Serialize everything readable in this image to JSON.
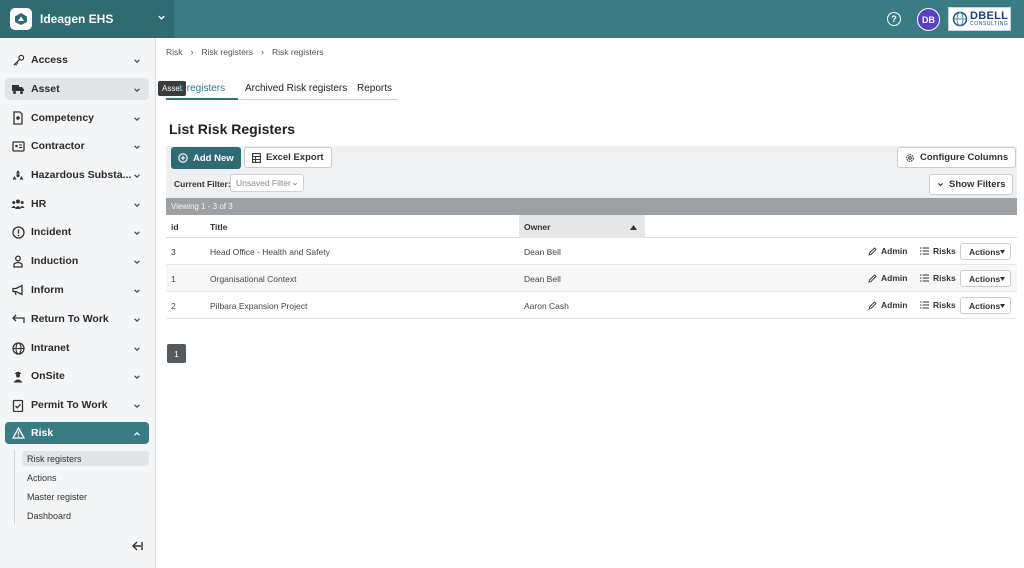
{
  "app": {
    "title": "Ideagen EHS",
    "avatar_initials": "DB",
    "company_logo_line1": "DBELL",
    "company_logo_line2": "CONSULTING",
    "accent": "#3a7c84"
  },
  "sidebar": {
    "items": [
      {
        "label": "Access",
        "icon": "key-icon"
      },
      {
        "label": "Asset",
        "icon": "truck-icon"
      },
      {
        "label": "Competency",
        "icon": "certificate-icon"
      },
      {
        "label": "Contractor",
        "icon": "id-card-icon"
      },
      {
        "label": "Hazardous Substa...",
        "icon": "hazard-icon"
      },
      {
        "label": "HR",
        "icon": "people-icon"
      },
      {
        "label": "Incident",
        "icon": "alert-circle-icon"
      },
      {
        "label": "Induction",
        "icon": "person-badge-icon"
      },
      {
        "label": "Inform",
        "icon": "megaphone-icon"
      },
      {
        "label": "Return To Work",
        "icon": "return-arrow-icon"
      },
      {
        "label": "Intranet",
        "icon": "globe-icon"
      },
      {
        "label": "OnSite",
        "icon": "worker-icon"
      },
      {
        "label": "Permit To Work",
        "icon": "clipboard-check-icon"
      },
      {
        "label": "Risk",
        "icon": "warning-triangle-icon"
      }
    ],
    "risk_sub_items": [
      "Risk registers",
      "Actions",
      "Master register",
      "Dashboard"
    ],
    "tooltip": "Asset"
  },
  "breadcrumb": [
    "Risk",
    "Risk registers",
    "Risk registers"
  ],
  "tabs": [
    {
      "label": "Risk registers",
      "visible_label": "k registers"
    },
    {
      "label": "Archived Risk registers"
    },
    {
      "label": "Reports"
    }
  ],
  "page": {
    "title": "List Risk Registers"
  },
  "toolbar": {
    "add_new": "Add New",
    "excel_export": "Excel Export",
    "configure_columns": "Configure Columns",
    "current_filter_label": "Current Filter:",
    "filter_value": "Unsaved Filter",
    "show_filters": "Show Filters"
  },
  "table": {
    "viewing": "Viewing 1 - 3 of 3",
    "columns": [
      "id",
      "Title",
      "Owner"
    ],
    "rows": [
      {
        "id": "3",
        "title": "Head Office - Health and Safety",
        "owner": "Dean Bell"
      },
      {
        "id": "1",
        "title": "Organisational Context",
        "owner": "Dean Bell"
      },
      {
        "id": "2",
        "title": "Pilbara Expansion Project",
        "owner": "Aaron Cash"
      }
    ],
    "row_admin_label": "Admin",
    "row_risks_label": "Risks",
    "row_actions_label": "Actions"
  },
  "pagination": {
    "current_page": "1"
  }
}
